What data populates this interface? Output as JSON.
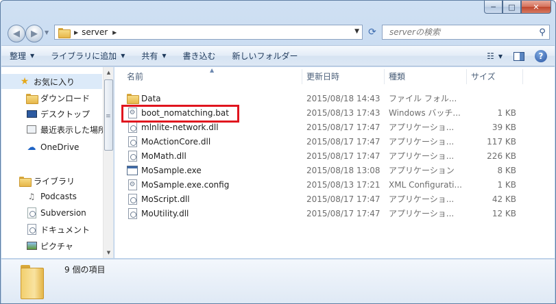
{
  "window": {
    "caption_min": "─",
    "caption_max": "□",
    "caption_close": "✕"
  },
  "address": {
    "crumb": "server",
    "refresh_glyph": "⟳"
  },
  "search": {
    "placeholder": "serverの検索",
    "icon": "search-icon"
  },
  "toolbar": {
    "items": [
      "整理",
      "ライブラリに追加",
      "共有",
      "書き込む",
      "新しいフォルダー"
    ],
    "has_dropdown": [
      true,
      true,
      true,
      false,
      false
    ]
  },
  "nav": {
    "items": [
      {
        "label": "お気に入り",
        "icon": "star-icon",
        "selected": true
      },
      {
        "label": "ダウンロード",
        "icon": "downloads-icon"
      },
      {
        "label": "デスクトップ",
        "icon": "desktop-icon"
      },
      {
        "label": "最近表示した場所",
        "icon": "recent-places-icon"
      },
      {
        "label": "OneDrive",
        "icon": "cloud-icon"
      },
      {
        "label": "ライブラリ",
        "icon": "library-icon"
      },
      {
        "label": "Podcasts",
        "icon": "podcast-icon"
      },
      {
        "label": "Subversion",
        "icon": "document-icon"
      },
      {
        "label": "ドキュメント",
        "icon": "document-icon"
      },
      {
        "label": "ピクチャ",
        "icon": "pictures-icon"
      }
    ]
  },
  "columns": {
    "name": "名前",
    "date": "更新日時",
    "type": "種類",
    "size": "サイズ"
  },
  "files": [
    {
      "name": "Data",
      "date": "2015/08/18 14:43",
      "type": "ファイル フォル...",
      "size": "",
      "icon": "folder-icon"
    },
    {
      "name": "boot_nomatching.bat",
      "date": "2015/08/13 17:43",
      "type": "Windows バッチ...",
      "size": "1 KB",
      "icon": "batch-file-icon"
    },
    {
      "name": "mlnlite-network.dll",
      "date": "2015/08/17 17:47",
      "type": "アプリケーショ...",
      "size": "39 KB",
      "icon": "dll-icon"
    },
    {
      "name": "MoActionCore.dll",
      "date": "2015/08/17 17:47",
      "type": "アプリケーショ...",
      "size": "117 KB",
      "icon": "dll-icon"
    },
    {
      "name": "MoMath.dll",
      "date": "2015/08/17 17:47",
      "type": "アプリケーショ...",
      "size": "226 KB",
      "icon": "dll-icon"
    },
    {
      "name": "MoSample.exe",
      "date": "2015/08/18 13:08",
      "type": "アプリケーション",
      "size": "8 KB",
      "icon": "exe-icon"
    },
    {
      "name": "MoSample.exe.config",
      "date": "2015/08/13 17:21",
      "type": "XML Configurati...",
      "size": "1 KB",
      "icon": "config-file-icon"
    },
    {
      "name": "MoScript.dll",
      "date": "2015/08/17 17:47",
      "type": "アプリケーショ...",
      "size": "42 KB",
      "icon": "dll-icon"
    },
    {
      "name": "MoUtility.dll",
      "date": "2015/08/17 17:47",
      "type": "アプリケーショ...",
      "size": "12 KB",
      "icon": "dll-icon"
    }
  ],
  "highlighted_file": "boot_nomatching.bat",
  "highlight_color": "#e0141e",
  "status": {
    "text": "9 個の項目"
  }
}
